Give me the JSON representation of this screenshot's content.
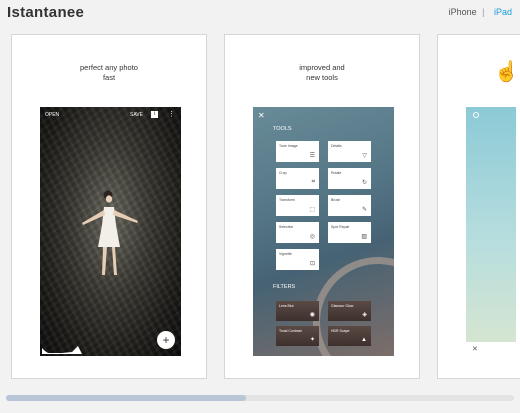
{
  "header": {
    "title": "Istantanee",
    "device_iphone": "iPhone",
    "separator": "|",
    "device_ipad": "iPad"
  },
  "cards": [
    {
      "caption_line1": "perfect any photo",
      "caption_line2": "fast",
      "screen": {
        "open_label": "OPEN",
        "save_label": "SAVE",
        "menu_icon": "more-vert-icon",
        "fab_icon": "plus-icon"
      }
    },
    {
      "caption_line1": "improved and",
      "caption_line2": "new tools",
      "screen": {
        "tools_heading": "TOOLS",
        "tools": [
          "Tune Image",
          "Details",
          "Crop",
          "Rotate",
          "Transform",
          "Brush",
          "Selective",
          "Spot Repair",
          "Vignette"
        ],
        "filters_heading": "FILTERS",
        "filters": [
          "Lens Blur",
          "Glamour Glow",
          "Tonal Contrast",
          "HDR Scape"
        ]
      }
    },
    {
      "caption_line1": "",
      "caption_line2": ""
    }
  ],
  "colors": {
    "accent": "#1a9bdc",
    "scroll_thumb": "#b8c6d8"
  }
}
